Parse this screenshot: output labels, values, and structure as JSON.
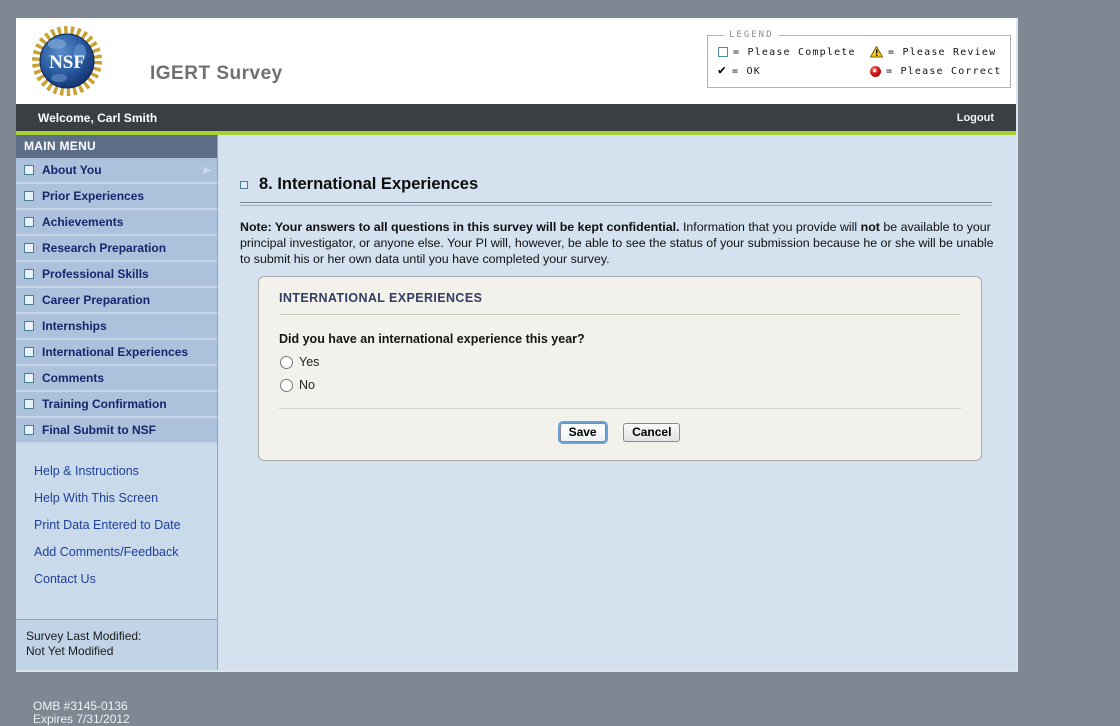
{
  "header": {
    "app_title": "IGERT Survey",
    "logo_text": "NSF"
  },
  "legend": {
    "title": "LEGEND",
    "items": [
      {
        "icon": "checkbox-outline-icon",
        "label": "= Please Complete"
      },
      {
        "icon": "warning-icon",
        "label": "= Please Review"
      },
      {
        "icon": "checkmark-icon",
        "label": "= OK"
      },
      {
        "icon": "error-icon",
        "label": "= Please Correct"
      }
    ]
  },
  "welcome_bar": {
    "welcome_text": "Welcome, Carl Smith",
    "logout_label": "Logout"
  },
  "sidebar": {
    "menu_title": "MAIN MENU",
    "items": [
      {
        "label": "About You"
      },
      {
        "label": "Prior Experiences"
      },
      {
        "label": "Achievements"
      },
      {
        "label": "Research Preparation"
      },
      {
        "label": "Professional Skills"
      },
      {
        "label": "Career Preparation"
      },
      {
        "label": "Internships"
      },
      {
        "label": "International Experiences"
      },
      {
        "label": "Comments"
      },
      {
        "label": "Training Confirmation"
      },
      {
        "label": "Final Submit to NSF"
      }
    ],
    "links": [
      "Help & Instructions",
      "Help With This Screen",
      "Print Data Entered to Date",
      "Add Comments/Feedback",
      "Contact Us"
    ],
    "last_modified_label": "Survey Last Modified:",
    "last_modified_value": "Not Yet Modified"
  },
  "main": {
    "page_title": "8. International Experiences",
    "note": {
      "bold_intro": "Note: Your answers to all questions in this survey will be kept confidential.",
      "seg1": " Information that you provide will ",
      "bold_not": "not",
      "seg2": " be available to your principal investigator, or anyone else. Your PI will, however, be able to see the status of your submission because he or she will be unable to submit his or her own data until you have completed your survey."
    },
    "form": {
      "title": "INTERNATIONAL EXPERIENCES",
      "question": "Did you have an international experience this year?",
      "options": [
        "Yes",
        "No"
      ],
      "save_label": "Save",
      "cancel_label": "Cancel"
    }
  },
  "footer": {
    "omb_line1": "OMB #3145-0136",
    "omb_line2": "Expires 7/31/2012"
  },
  "colors": {
    "page_background": "#7d8893",
    "accent_green": "#a8cf33",
    "sidebar_item": "#abc1dc",
    "menu_header": "#5c6e88",
    "content_background": "#d3e2ee",
    "form_background": "#f2f1eb",
    "nav_text": "#17256b"
  }
}
